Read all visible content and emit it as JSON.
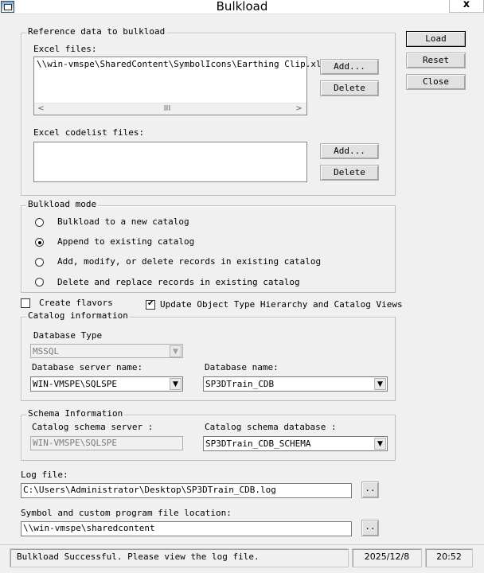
{
  "window": {
    "title": "Bulkload",
    "close_label": "x"
  },
  "side_buttons": {
    "load": "Load",
    "reset": "Reset",
    "close": "Close"
  },
  "reference": {
    "legend": "Reference data to bulkload",
    "excel_files_label": "Excel files:",
    "excel_files": [
      "\\\\win-vmspe\\SharedContent\\SymbolIcons\\Earthing Clip.xls"
    ],
    "add_label": "Add...",
    "delete_label": "Delete",
    "codelist_label": "Excel codelist files:",
    "codelist_files": [],
    "scroll": {
      "left": "<",
      "right": ">",
      "thumb": "III"
    }
  },
  "mode": {
    "legend": "Bulkload mode",
    "options": [
      {
        "label": "Bulkload to a new catalog",
        "selected": false
      },
      {
        "label": "Append to existing  catalog",
        "selected": true
      },
      {
        "label": "Add, modify, or delete records in existing catalog",
        "selected": false
      },
      {
        "label": "Delete and replace records in existing catalog",
        "selected": false
      }
    ]
  },
  "options": {
    "create_flavors": {
      "label": "Create flavors",
      "checked": false
    },
    "update_hierarchy": {
      "label": "Update Object Type Hierarchy and Catalog Views",
      "checked": true
    }
  },
  "catalog": {
    "legend": "Catalog information",
    "db_type_label": "Database Type",
    "db_type_value": "MSSQL",
    "server_label": "Database server name:",
    "server_value": "WIN-VMSPE\\SQLSPE",
    "dbname_label": "Database name:",
    "dbname_value": "SP3DTrain_CDB"
  },
  "schema": {
    "legend": "Schema Information",
    "server_label": "Catalog schema server :",
    "server_value": "WIN-VMSPE\\SQLSPE",
    "db_label": "Catalog schema database :",
    "db_value": "SP3DTrain_CDB_SCHEMA"
  },
  "log": {
    "label": "Log file:",
    "value": "C:\\Users\\Administrator\\Desktop\\SP3DTrain_CDB.log",
    "browse_label": ".."
  },
  "symbol": {
    "label": "Symbol and custom program file location:",
    "value": "\\\\win-vmspe\\sharedcontent",
    "browse_label": ".."
  },
  "status": {
    "message": "Bulkload Successful. Please view the log file.",
    "date": "2025/12/8",
    "time": "20:52"
  },
  "icons": {
    "dropdown": "▼",
    "radio": "radio-button",
    "check": "checkmark"
  }
}
